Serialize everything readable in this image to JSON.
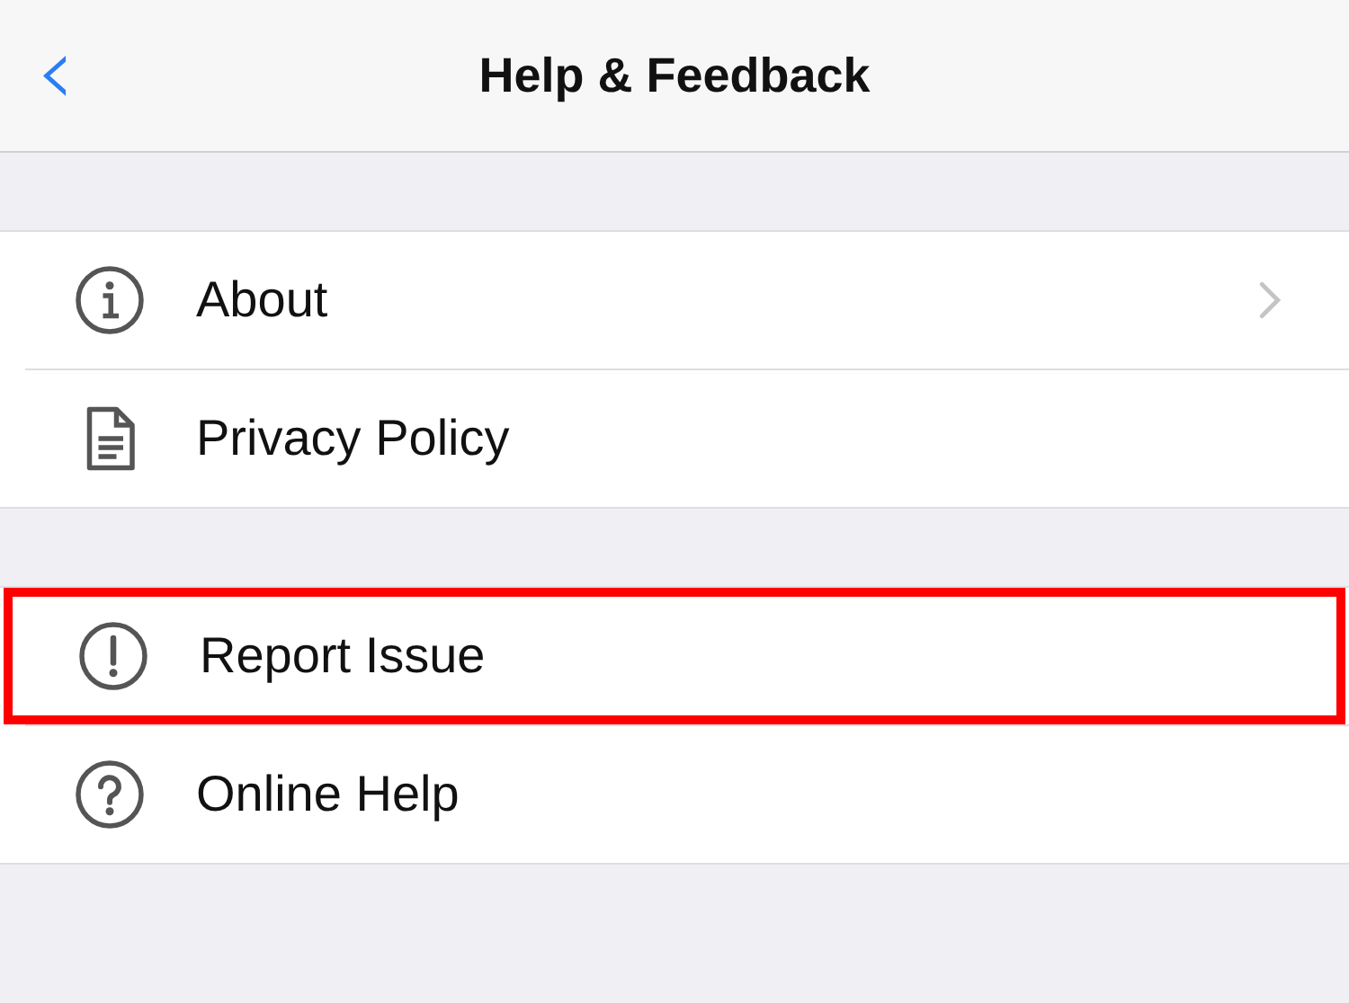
{
  "nav_bar": {
    "back": "‹",
    "title": "Help & Feedback"
  },
  "groups": [
    {
      "items": [
        {
          "label": "About",
          "chevron": true,
          "highlighted": false
        },
        {
          "label": "Privacy Policy",
          "chevron": false,
          "highlighted": false
        }
      ]
    },
    {
      "items": [
        {
          "label": "Report Issue",
          "chevron": false,
          "highlighted": true
        },
        {
          "label": "Online Help",
          "chevron": false,
          "highlighted": false
        }
      ]
    }
  ]
}
